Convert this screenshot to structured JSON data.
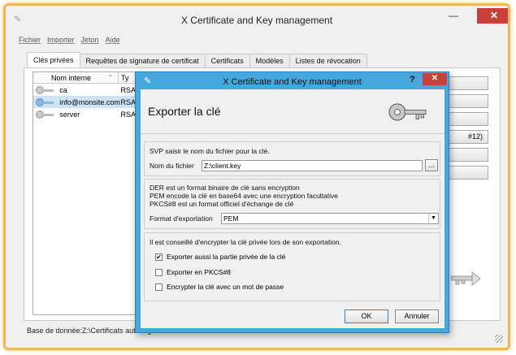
{
  "window": {
    "title": "X Certificate and Key management"
  },
  "menu": [
    "Fichier",
    "Importer",
    "Jeton",
    "Aide"
  ],
  "tabs": [
    "Clés privées",
    "Requêtes de signature de certificat",
    "Certificats",
    "Modèles",
    "Listes de révocation"
  ],
  "keylist": {
    "headers": [
      "Nom interne",
      "Ty"
    ],
    "rows": [
      {
        "name": "ca",
        "type": "RSA"
      },
      {
        "name": "info@monsite.com",
        "type": "RSA"
      },
      {
        "name": "server",
        "type": "RSA"
      }
    ]
  },
  "right_button_partial": "#12)",
  "status": {
    "text": "Base de donnée:Z:\\Certificats auto-signés cloud.monsite.com.xdb"
  },
  "dialog": {
    "title": "X Certificate and Key management",
    "help": "?",
    "close": "x",
    "heading": "Exporter la clé",
    "filename_group": {
      "instruction": "SVP saisir le nom du fichier pour la clé.",
      "label": "Nom du fichier",
      "value": "Z:\\client.key",
      "browse": "..."
    },
    "format_group": {
      "line1": "DER est un format binaire de clé sans encryption",
      "line2": "PEM encode la clé en base64 avec une encryption facultative",
      "line3": "PKCS#8 est un format officiel d'échange de clé",
      "label": "Format d'exportation",
      "selected": "PEM"
    },
    "options_group": {
      "advice": "Il est conseillé d'encrypter la clé privée lors de son exportation.",
      "checkboxes": [
        {
          "label": "Exporter aussi la partie privée de la clé",
          "checked": true
        },
        {
          "label": "Exporter en PKCS#8",
          "checked": false
        },
        {
          "label": "Encrypter la clé avec un mot de passe",
          "checked": false
        }
      ]
    },
    "ok": "OK",
    "cancel": "Annuler"
  }
}
